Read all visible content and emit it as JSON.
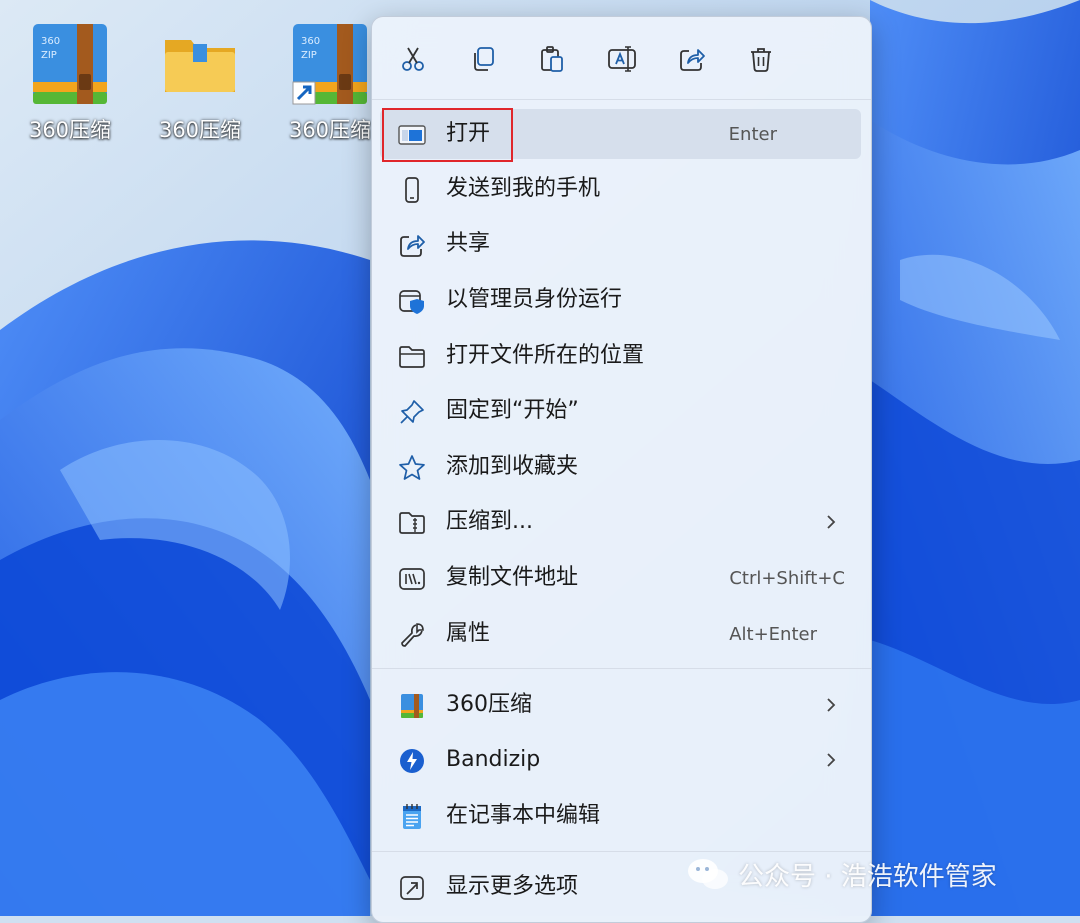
{
  "desktop": {
    "icons": [
      {
        "label": "360压缩",
        "icon": "zip-archive-icon"
      },
      {
        "label": "360压缩",
        "icon": "folder-icon"
      },
      {
        "label": "360压缩",
        "icon": "zip-archive-shortcut-icon"
      }
    ]
  },
  "menu": {
    "toolbar": [
      {
        "icon": "cut-icon"
      },
      {
        "icon": "copy-icon"
      },
      {
        "icon": "paste-icon"
      },
      {
        "icon": "rename-icon"
      },
      {
        "icon": "share-icon"
      },
      {
        "icon": "delete-icon"
      }
    ],
    "items": [
      {
        "label": "打开",
        "shortcut": "Enter",
        "icon": "open-window-icon"
      },
      {
        "label": "发送到我的手机",
        "icon": "phone-icon"
      },
      {
        "label": "共享",
        "icon": "share-icon"
      },
      {
        "label": "以管理员身份运行",
        "icon": "admin-shield-icon"
      },
      {
        "label": "打开文件所在的位置",
        "icon": "folder-open-icon"
      },
      {
        "label": "固定到“开始”",
        "icon": "pin-icon"
      },
      {
        "label": "添加到收藏夹",
        "icon": "star-icon"
      },
      {
        "label": "压缩到...",
        "icon": "zip-folder-icon",
        "submenu": true
      },
      {
        "label": "复制文件地址",
        "shortcut": "Ctrl+Shift+C",
        "icon": "copy-path-icon"
      },
      {
        "label": "属性",
        "shortcut": "Alt+Enter",
        "icon": "wrench-icon"
      },
      {
        "label": "360压缩",
        "icon": "360zip-app-icon",
        "submenu": true
      },
      {
        "label": "Bandizip",
        "icon": "bandizip-app-icon",
        "submenu": true
      },
      {
        "label": "在记事本中编辑",
        "icon": "notepad-icon"
      },
      {
        "label": "显示更多选项",
        "icon": "more-options-icon"
      }
    ]
  },
  "watermark": {
    "text": "公众号 · 浩浩软件管家"
  },
  "colors": {
    "highlight_border": "#e0262b",
    "accent": "#0067c0"
  }
}
